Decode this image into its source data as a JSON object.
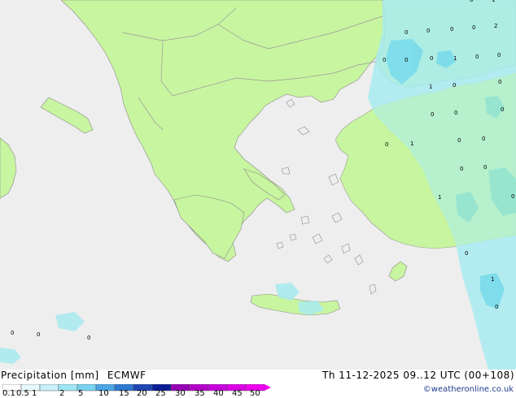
{
  "title": "Precipitation [mm]",
  "model": "ECMWF",
  "datetime": "Th 11-12-2025 09..12 UTC (00+108)",
  "credit": "©weatheronline.co.uk",
  "colors": {
    "sea": "#eeeeee",
    "land": "#c8f5a0",
    "light_precip": "#a8ebf0",
    "moderate_precip": "#7adbea"
  },
  "legend": {
    "labels": [
      "0.1",
      "0.5",
      "1",
      "2",
      "5",
      "10",
      "15",
      "20",
      "25",
      "30",
      "35",
      "40",
      "45",
      "50"
    ],
    "colors": [
      "#ffffff",
      "#e6faff",
      "#c8f0fa",
      "#a0e6f5",
      "#78d2f0",
      "#4ba5e6",
      "#2d78d2",
      "#1e46b4",
      "#0a1e96",
      "#9600b4",
      "#b400c8",
      "#c800dc",
      "#dc00e6",
      "#f000f0"
    ]
  },
  "point_labels": [
    {
      "t": "0"
    },
    {
      "t": "1"
    },
    {
      "t": "0"
    },
    {
      "t": "0"
    },
    {
      "t": "0"
    },
    {
      "t": "0"
    },
    {
      "t": "2"
    },
    {
      "t": "0"
    },
    {
      "t": "0"
    },
    {
      "t": "0"
    },
    {
      "t": "1"
    },
    {
      "t": "0"
    },
    {
      "t": "0"
    },
    {
      "t": "1"
    },
    {
      "t": "0"
    },
    {
      "t": "0"
    },
    {
      "t": "0"
    },
    {
      "t": "0"
    },
    {
      "t": "0"
    },
    {
      "t": "0"
    },
    {
      "t": "1"
    },
    {
      "t": "0"
    },
    {
      "t": "0"
    },
    {
      "t": "0"
    },
    {
      "t": "0"
    },
    {
      "t": "1"
    },
    {
      "t": "0"
    },
    {
      "t": "0"
    },
    {
      "t": "1"
    },
    {
      "t": "0"
    },
    {
      "t": "0"
    },
    {
      "t": "0"
    },
    {
      "t": "0"
    }
  ]
}
